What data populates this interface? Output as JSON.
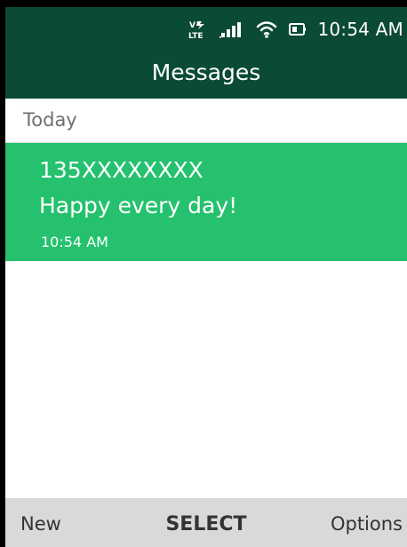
{
  "status_bar": {
    "network_label": "LTE",
    "time": "10:54 AM"
  },
  "header": {
    "title": "Messages"
  },
  "sections": [
    {
      "label": "Today"
    }
  ],
  "messages": [
    {
      "sender": "135XXXXXXXX",
      "body": "Happy every day!",
      "time": "10:54 AM",
      "selected": true
    }
  ],
  "softkeys": {
    "left": "New",
    "center": "SELECT",
    "right": "Options"
  },
  "icons": [
    "volte-lte-icon",
    "signal-strength-icon",
    "wifi-icon",
    "battery-icon"
  ],
  "colors": {
    "header_background": "#0b4a35",
    "selected_item": "#25c16f",
    "softkey_bar": "#d9d9d9",
    "section_text": "#6f6f6f"
  }
}
